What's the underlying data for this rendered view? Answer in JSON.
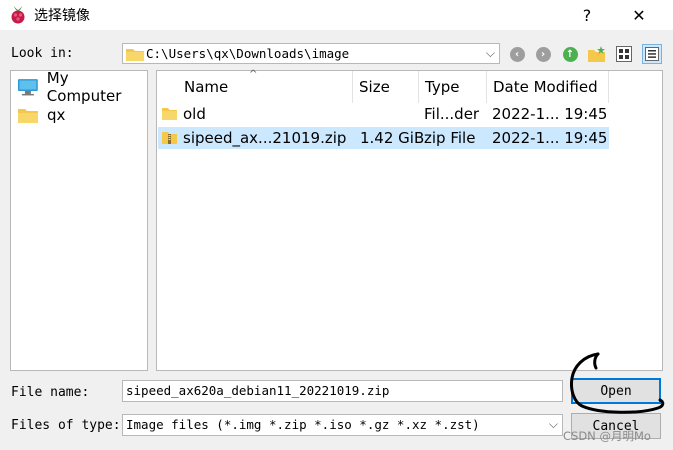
{
  "window": {
    "title": "选择镜像",
    "help": "?",
    "close": "✕"
  },
  "lookin": {
    "label": "Look in:",
    "path": "C:\\Users\\qx\\Downloads\\image",
    "arrow": "⌵"
  },
  "icons": [
    "raspberry-icon",
    "back-icon",
    "forward-icon",
    "up-icon",
    "new-folder-icon",
    "icon-view-icon",
    "detail-view-icon",
    "folder-icon",
    "computer-icon",
    "zip-icon"
  ],
  "sidebar": {
    "items": [
      {
        "label": "My Computer",
        "icon": "computer-icon"
      },
      {
        "label": "qx",
        "icon": "folder-icon"
      }
    ]
  },
  "table": {
    "headers": [
      "Name",
      "Size",
      "Type",
      "Date Modified"
    ],
    "sort_indicator": "^",
    "rows": [
      {
        "name": "old",
        "size": "",
        "type": "Fil...der",
        "date": "2022-1... 19:45",
        "icon": "folder-icon"
      },
      {
        "name": "sipeed_ax...21019.zip",
        "size": "1.42 GiB",
        "type": "zip File",
        "date": "2022-1... 19:45",
        "icon": "zip-icon"
      }
    ]
  },
  "filename": {
    "label": "File name:",
    "value": "sipeed_ax620a_debian11_20221019.zip"
  },
  "filetype": {
    "label": "Files of type:",
    "value": "Image files (*.img *.zip *.iso *.gz *.xz *.zst)",
    "arrow": "⌵"
  },
  "buttons": {
    "open": "Open",
    "cancel": "Cancel"
  },
  "watermark": "CSDN @月明Mo",
  "colors": {
    "selection": "#cce8ff",
    "folder": "#f5c84c",
    "accent": "#0078d7",
    "nav_green": "#4caf50",
    "nav_gray": "#9e9e9e"
  }
}
